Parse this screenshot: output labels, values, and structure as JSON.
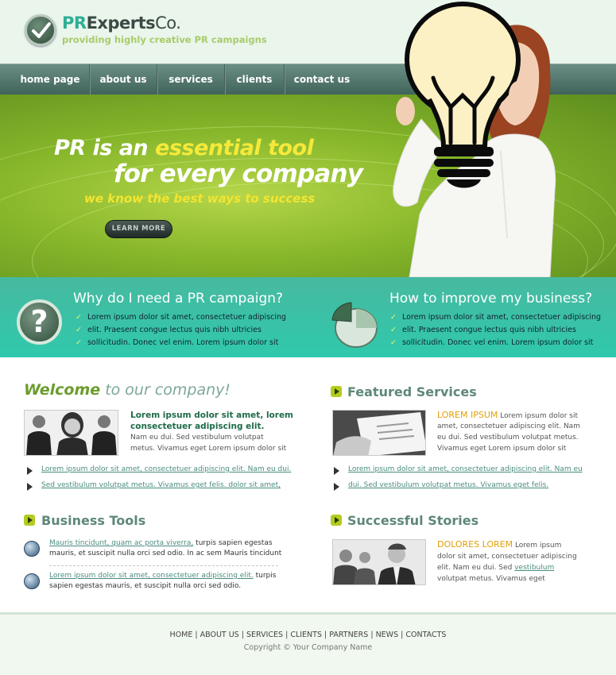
{
  "brand": {
    "pr": "PR",
    "experts": "Experts",
    "co": "Co.",
    "tagline": "providing highly creative PR campaigns"
  },
  "nav": [
    "home page",
    "about us",
    "services",
    "clients",
    "contact us"
  ],
  "hero": {
    "line1_prefix": "PR is an ",
    "line1_accent": "essential tool",
    "line2": "for every company",
    "line3": "we know the best ways to success",
    "button": "LEARN MORE"
  },
  "strip": {
    "left_title": "Why do I need a PR campaign?",
    "right_title": "How to improve my business?",
    "bullets": [
      "Lorem ipsum dolor sit amet, consectetuer adipiscing",
      "elit. Praesent congue lectus quis nibh ultricies",
      "sollicitudin. Donec vel enim. Lorem ipsum dolor sit"
    ]
  },
  "welcome": {
    "bold": "Welcome",
    "rest": " to our company!",
    "strong_1": "Lorem ipsum dolor sit amet, lorem",
    "strong_2": "consectetuer adipiscing elit.",
    "text_1": "Nam eu dui. Sed vestibulum volutpat",
    "text_2": "metus. Vivamus eget Lorem ipsum dolor sit",
    "links": [
      "Lorem ipsum dolor sit amet, consectetuer adipiscing elit. Nam eu dui.",
      "Sed vestibulum volutpat metus. Vivamus eget felis. dolor sit amet,"
    ]
  },
  "featured": {
    "title": "Featured Services",
    "accent": "LOREM IPSUM",
    "text_1": " Lorem ipsum dolor sit",
    "text_2": "amet, consectetuer adipiscing elit. Nam",
    "text_3": "eu dui. Sed vestibulum volutpat metus.",
    "text_4": "Vivamus eget Lorem ipsum dolor sit",
    "links": [
      "Lorem ipsum dolor sit amet, consectetuer adipiscing elit. Nam eu",
      "dui. Sed vestibulum volutpat metus. Vivamus eget felis."
    ]
  },
  "tools": {
    "title": "Business Tools",
    "items": [
      {
        "link": "Mauris tincidunt, quam ac porta viverra,",
        "line1_rest": " turpis sapien egestas",
        "line2": "mauris, et suscipit nulla orci sed odio. In ac sem Mauris tincidunt"
      },
      {
        "link": "Lorem ipsum dolor sit amet, consectetuer adipiscing elit.",
        "line1_rest": " turpis",
        "line2": "sapien egestas mauris, et suscipit nulla orci sed odio."
      }
    ]
  },
  "stories": {
    "title": "Successful Stories",
    "accent": "DOLORES LOREM",
    "text_1": " Lorem ipsum",
    "text_2": "dolor sit amet, consectetuer adipiscing",
    "text_3_pre": "elit. Nam eu dui. Sed ",
    "text_3_link": "vestibulum",
    "text_4": "volutpat metus. Vivamus eget"
  },
  "footer": {
    "links": [
      "HOME",
      "ABOUT US",
      "SERVICES",
      "CLIENTS",
      "PARTNERS",
      "NEWS",
      "CONTACTS"
    ],
    "separator": " | ",
    "copyright": "Copyright © Your Company Name"
  },
  "colors": {
    "brand_teal": "#2fae96",
    "nav_bg": "#4f7168",
    "hero_green": "#86b62a",
    "strip_teal": "#3cc2a6",
    "accent_yellow": "#f5e93a",
    "accent_orange": "#e2a00a"
  }
}
